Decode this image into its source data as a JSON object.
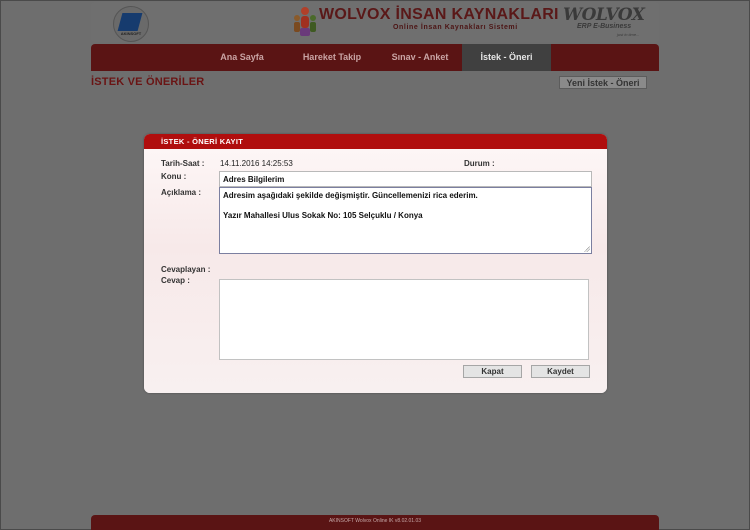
{
  "header": {
    "company_logo_text": "AKINSOFT",
    "brand_title": "WOLVOX İNSAN KAYNAKLARI",
    "brand_subtitle": "Online İnsan Kaynakları Sistemi",
    "product_logo": "WOLVOX",
    "product_subtitle": "ERP E-Business",
    "product_tagline": "just in time..."
  },
  "nav": {
    "items": [
      {
        "label": "Ana Sayfa",
        "active": false
      },
      {
        "label": "Hareket Takip",
        "active": false
      },
      {
        "label": "Sınav - Anket",
        "active": false
      },
      {
        "label": "İstek - Öneri",
        "active": true
      }
    ]
  },
  "page": {
    "title": "İSTEK VE ÖNERİLER",
    "new_button": "Yeni İstek - Öneri"
  },
  "dialog": {
    "title": "İSTEK - ÖNERİ KAYIT",
    "date_label": "Tarih-Saat :",
    "date_value": "14.11.2016 14:25:53",
    "status_label": "Durum :",
    "subject_label": "Konu :",
    "subject_value": "Adres Bilgilerim",
    "description_label": "Açıklama :",
    "description_line1": "Adresim aşağıdaki şekilde değişmiştir.  Güncellemenizi rica ederim.",
    "description_line2": "Yazır Mahallesi Ulus Sokak No: 105 Selçuklu / Konya",
    "responder_label": "Cevaplayan :",
    "answer_label": "Cevap :",
    "answer_value": "",
    "close_button": "Kapat",
    "save_button": "Kaydet"
  },
  "footer": {
    "text": "AKINSOFT Wolvox Online IK v8.02.01.03"
  },
  "colors": {
    "accent": "#b00e0e",
    "nav_bg": "#5a1414",
    "overlay_bg": "#6e6e6e"
  }
}
